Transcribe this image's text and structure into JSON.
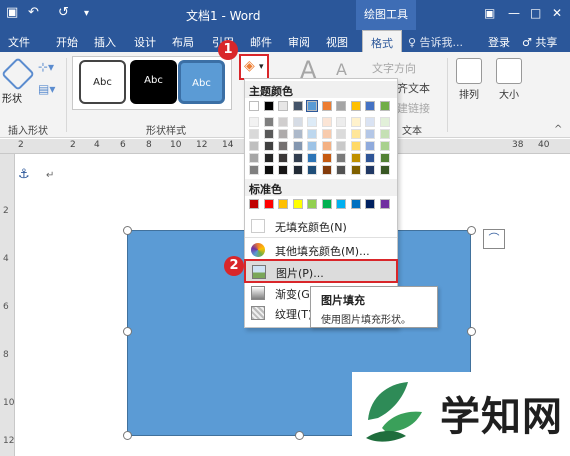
{
  "title_bar": {
    "undo": "↶",
    "redo": "↺",
    "customize": "▾",
    "doc_title": "文档1 - Word",
    "context_tab": "绘图工具",
    "win_restore": "▣",
    "win_min": "—",
    "win_max": "□",
    "win_close": "✕"
  },
  "tabs": [
    "文件",
    "开始",
    "插入",
    "设计",
    "布局",
    "引用",
    "邮件",
    "审阅",
    "视图",
    "格式"
  ],
  "tell_me": "♀ 告诉我...",
  "login": "登录",
  "share": "♂ 共享",
  "ribbon": {
    "shape_label": "形状",
    "insert_shape_group": "插入形状",
    "shape_styles_group": "形状样式",
    "style_samples": [
      "Abc",
      "Abc",
      "Abc"
    ],
    "wordart_a1": "A",
    "wordart_a2": "A",
    "text_direction": "文字方向",
    "align_text": "齐文本",
    "create_link": "建链接",
    "text_group": "文本",
    "arrange": "排列",
    "size": "大小"
  },
  "ruler_numbers": [
    "2",
    "2",
    "4",
    "6",
    "8",
    "10",
    "12",
    "14",
    "16",
    "18",
    "38",
    "40"
  ],
  "vruler_numbers": [
    "2",
    "4",
    "6",
    "8",
    "10",
    "12"
  ],
  "fill_dropdown": {
    "theme_colors_heading": "主题颜色",
    "standard_colors_heading": "标准色",
    "items": [
      {
        "label": "无填充颜色(N)"
      },
      {
        "label": "其他填充颜色(M)..."
      },
      {
        "label": "图片(P)..."
      },
      {
        "label": "渐变(G)"
      },
      {
        "label": "纹理(T)"
      }
    ],
    "theme_top_row": [
      "#ffffff",
      "#000000",
      "#e7e6e6",
      "#44546a",
      "#5b9bd5",
      "#ed7d31",
      "#a5a5a5",
      "#ffc000",
      "#4472c4",
      "#70ad47"
    ],
    "theme_shades": [
      [
        "#f2f2f2",
        "#7f7f7f",
        "#d0cece",
        "#d6dce5",
        "#ddebf7",
        "#fbe5d6",
        "#ededed",
        "#fff2cc",
        "#dae3f3",
        "#e2f0d9"
      ],
      [
        "#d9d9d9",
        "#595959",
        "#aeabab",
        "#adb9ca",
        "#bdd7ee",
        "#f8cbad",
        "#dbdbdb",
        "#ffe699",
        "#b4c7e7",
        "#c5e0b4"
      ],
      [
        "#bfbfbf",
        "#404040",
        "#757171",
        "#8497b0",
        "#9dc3e6",
        "#f4b183",
        "#c9c9c9",
        "#ffd966",
        "#8faadc",
        "#a9d18e"
      ],
      [
        "#a6a6a6",
        "#262626",
        "#3b3838",
        "#333f50",
        "#2e75b6",
        "#c55a11",
        "#7b7b7b",
        "#bf9000",
        "#2f5597",
        "#538135"
      ],
      [
        "#7f7f7f",
        "#0d0d0d",
        "#171616",
        "#222a35",
        "#1f4e79",
        "#843c0c",
        "#525252",
        "#7f6000",
        "#203864",
        "#385723"
      ]
    ],
    "standard_colors": [
      "#c00000",
      "#ff0000",
      "#ffc000",
      "#ffff00",
      "#92d050",
      "#00b050",
      "#00b0f0",
      "#0070c0",
      "#002060",
      "#7030a0"
    ]
  },
  "tooltip": {
    "title": "图片填充",
    "body": "使用图片填充形状。"
  },
  "badges": [
    "1",
    "2"
  ],
  "document": {
    "paragraph_mark": "↵",
    "anchor": "⚓"
  },
  "watermark": {
    "text": "学知网"
  },
  "colors": {
    "accent": "#2b579a",
    "shape_fill": "#5b9bd5",
    "highlight_red": "#d9262a"
  }
}
